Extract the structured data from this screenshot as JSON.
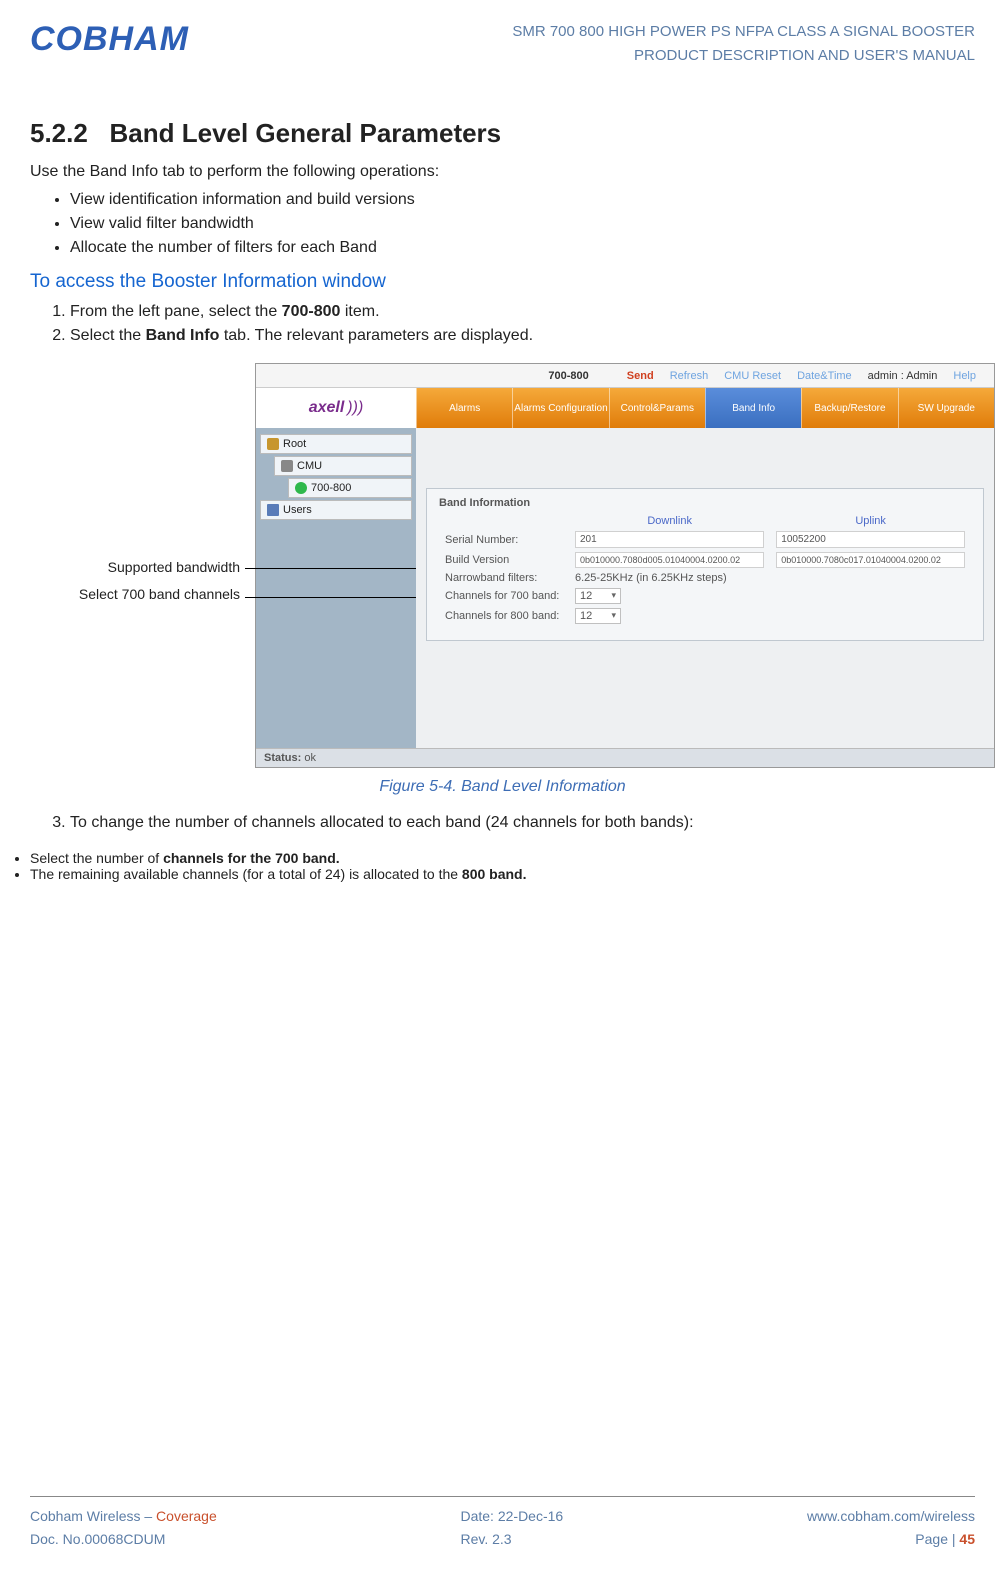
{
  "header": {
    "logo": "COBHAM",
    "title_line1": "SMR 700 800 HIGH POWER PS NFPA CLASS A SIGNAL BOOSTER",
    "title_line2": "PRODUCT DESCRIPTION AND USER'S MANUAL"
  },
  "section": {
    "number": "5.2.2",
    "title": "Band Level General Parameters",
    "intro": "Use the Band Info tab to perform the following operations:",
    "bullets": [
      "View identification information and build versions",
      "View valid filter bandwidth",
      "Allocate the number of filters for each Band"
    ],
    "access_heading": "To access the Booster Information window",
    "steps": [
      {
        "pre": "From the left pane, select the ",
        "bold": "700-800",
        "post": " item."
      },
      {
        "pre": "Select the ",
        "bold": "Band Info",
        "post": " tab. The relevant parameters are displayed."
      }
    ]
  },
  "annotations": {
    "a1": "Supported bandwidth",
    "a2": "Select 700 band channels"
  },
  "screenshot": {
    "topbar": {
      "title": "700-800",
      "send": "Send",
      "refresh": "Refresh",
      "cmu_reset": "CMU Reset",
      "datetime": "Date&Time",
      "admin": "admin : Admin",
      "help": "Help"
    },
    "axell": "axell",
    "tabs": [
      "Alarms",
      "Alarms Configuration",
      "Control&Params",
      "Band Info",
      "Backup/Restore",
      "SW Upgrade"
    ],
    "tree": {
      "root": "Root",
      "cmu": "CMU",
      "band": "700-800",
      "users": "Users"
    },
    "panel": {
      "title": "Band Information",
      "col_downlink": "Downlink",
      "col_uplink": "Uplink",
      "row_serial_label": "Serial Number:",
      "serial_dl_partial": "201",
      "serial_ul": "10052200",
      "row_build_label": "Build Version",
      "build_dl": "0b010000.7080d005.01040004.0200.02",
      "build_ul": "0b010000.7080c017.01040004.0200.02",
      "row_nb_label": "Narrowband filters:",
      "nb_value": "6.25-25KHz (in 6.25KHz steps)",
      "row_ch700_label": "Channels for 700 band:",
      "ch700_value": "12",
      "row_ch800_label": "Channels for 800 band:",
      "ch800_value": "12"
    },
    "status_label": "Status:",
    "status_value": "ok"
  },
  "figure_caption": "Figure 5-4. Band Level Information",
  "post_steps": {
    "step3": "To change the number of channels allocated to each band (24 channels for both bands):",
    "sub": [
      {
        "pre": "Select the number of ",
        "bold": "channels for the 700 band."
      },
      {
        "pre": "The remaining available channels (for a total of 24) is allocated to the ",
        "bold": "800 band."
      }
    ]
  },
  "footer": {
    "l1a": "Cobham Wireless – ",
    "l1b": "Coverage",
    "l2": "Doc. No.00068CDUM",
    "c1": "Date: 22-Dec-16",
    "c2": "Rev. 2.3",
    "r1": "www.cobham.com/wireless",
    "r2a": "Page | ",
    "r2b": "45"
  }
}
